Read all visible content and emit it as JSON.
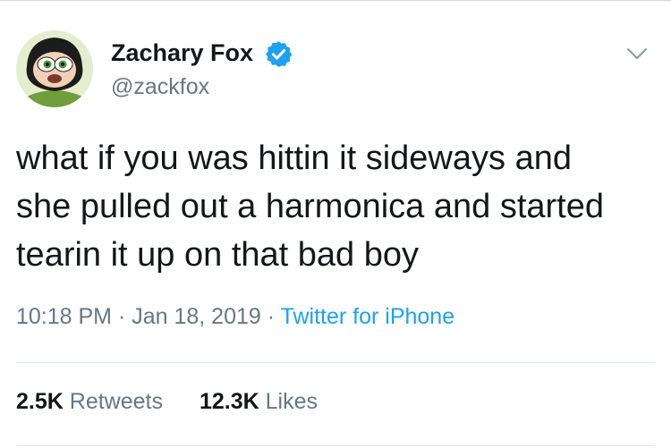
{
  "author": {
    "name": "Zachary Fox",
    "handle": "@zackfox",
    "verified": true,
    "avatar_icon": "buttercup-cartoon-avatar"
  },
  "tweet": {
    "lines": [
      "what if you was hittin it sideways and",
      "she pulled out a harmonica and started",
      "tearin it up on that bad boy"
    ]
  },
  "meta": {
    "time": "10:18 PM",
    "separator": " · ",
    "date": "Jan 18, 2019",
    "source": "Twitter for iPhone"
  },
  "stats": {
    "retweets_count": "2.5K",
    "retweets_label": "Retweets",
    "likes_count": "12.3K",
    "likes_label": "Likes"
  },
  "colors": {
    "text": "#14171a",
    "secondary": "#657786",
    "accent": "#1da1f2",
    "divider": "#e1e8ed"
  },
  "icons": {
    "verified": "verified-badge-icon",
    "menu": "chevron-down-icon"
  }
}
